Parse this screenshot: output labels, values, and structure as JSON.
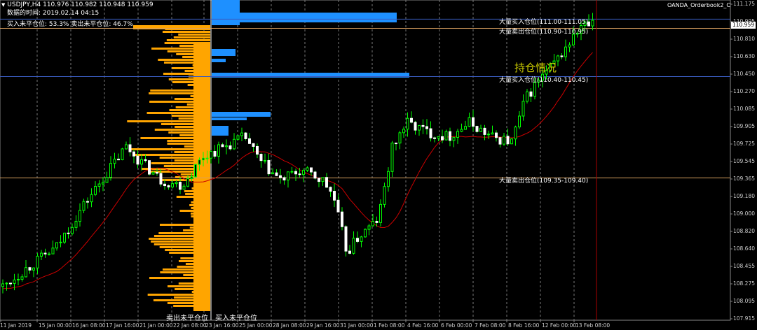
{
  "window": {
    "symbol_line": "USDJPY,H4  110.976 110.982 110.948 110.959",
    "indicator_name": "OANDA_Orderbook2_C"
  },
  "info": {
    "time_line": "数据的时间: 2019.02.14 04:15",
    "ratio_line": "买入未平仓位: 53.3%  卖出未平仓位: 46.7%"
  },
  "watermark": "持仓情况",
  "current_price": "110.959",
  "levels": [
    {
      "label": "大量买入仓位(111.00-111.05)",
      "price": 111.02,
      "line_color": "#3a5bbf"
    },
    {
      "label": "大量卖出仓位(110.90-110.95)",
      "price": 110.925,
      "line_color": "#d9a060"
    },
    {
      "label": "大量买入仓位(110.40-110.45)",
      "price": 110.425,
      "line_color": "#3a5bbf"
    },
    {
      "label": "大量卖出仓位(109.35-109.40)",
      "price": 109.375,
      "line_color": "#d9a060"
    }
  ],
  "bottom_labels": {
    "sell": "卖出未平仓位",
    "buy": "买入未平仓位"
  },
  "colors": {
    "up": "#00ff00",
    "down": "#ffffff",
    "ma": "#cc0000",
    "buy": "#1e90ff",
    "sell": "#ffa500",
    "grid": "#777777"
  },
  "chart_data": {
    "type": "candlestick",
    "ylim": [
      107.915,
      111.175
    ],
    "y_ticks": [
      "111.175",
      "110.995",
      "110.810",
      "110.630",
      "110.450",
      "110.270",
      "110.085",
      "109.905",
      "109.725",
      "109.545",
      "109.365",
      "109.180",
      "109.000",
      "108.820",
      "108.640",
      "108.455",
      "108.275",
      "108.095",
      "107.915"
    ],
    "x_ticks": [
      "11 Jan 2019",
      "15 Jan 00:00",
      "16 Jan 08:00",
      "17 Jan 16:00",
      "21 Jan 00:00",
      "22 Jan 08:00",
      "23 Jan 16:00",
      "25 Jan 00:00",
      "28 Jan 08:00",
      "29 Jan 16:00",
      "31 Jan 00:00",
      "1 Feb 08:00",
      "4 Feb 16:00",
      "6 Feb 00:00",
      "7 Feb 08:00",
      "8 Feb 16:00",
      "12 Feb 00:00",
      "13 Feb 08:00"
    ],
    "sell_profile_label": "卖出未平仓位",
    "buy_profile_label": "买入未平仓位"
  }
}
